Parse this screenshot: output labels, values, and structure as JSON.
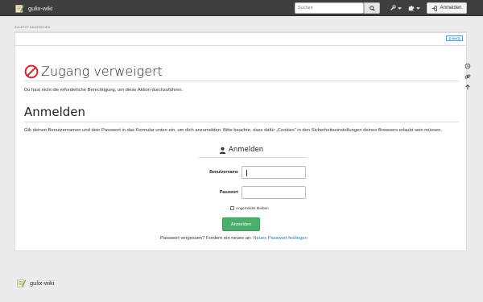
{
  "header": {
    "site_title": "gulix-wiki",
    "search_placeholder": "Suchen",
    "login_label": "Anmelden"
  },
  "trace": "ZULETZT ANGESEHEN",
  "edit_link": "[[ start ]]",
  "access": {
    "title": "Zugang verweigert",
    "message": "Du hast nicht die erforderliche Berechtigung, um diese Aktion durchzuführen."
  },
  "login_section": {
    "heading": "Anmelden",
    "intro": "Gib deinen Benutzernamen und dein Passwort in das Formular unten ein, um dich anzumelden. Bitte beachte, dass dafür „Cookies“ in den Sicherheitseinstellungen deines Browsers erlaubt sein müssen."
  },
  "form": {
    "title": "Anmelden",
    "username_label": "Benutzername",
    "username_value": "",
    "password_label": "Passwort",
    "password_value": "",
    "remember_label": "Angemeldet bleiben",
    "submit_label": "Anmelden",
    "forgot_text": "Passwort vergessen? Fordere ein neues an:",
    "forgot_link": "Neues Passwort festlegen"
  },
  "footer": {
    "site_title": "gulix-wiki"
  },
  "colors": {
    "navbar": "#3e3e3e",
    "submit": "#4cae6b",
    "link": "#2b7bb9",
    "forbidden": "#d9252a"
  }
}
